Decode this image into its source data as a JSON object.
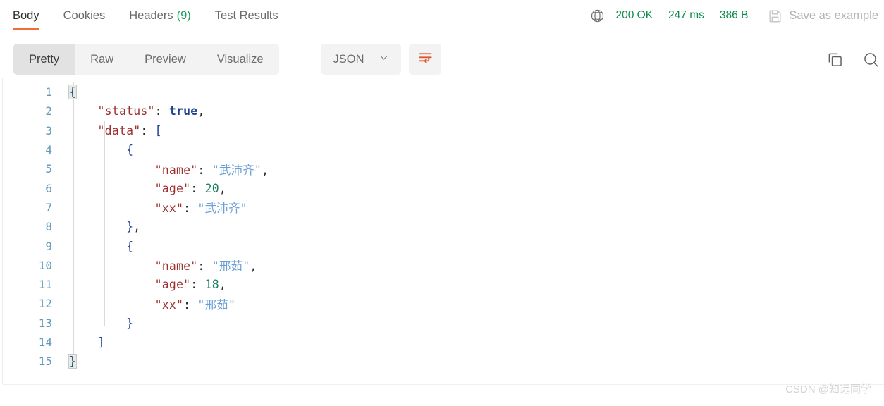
{
  "response_header": {
    "tabs": [
      {
        "label": "Body",
        "count": "",
        "active": true
      },
      {
        "label": "Cookies",
        "count": "",
        "active": false
      },
      {
        "label": "Headers",
        "count": "(9)",
        "active": false
      },
      {
        "label": "Test Results",
        "count": "",
        "active": false
      }
    ],
    "globe_icon": "globe-icon",
    "status_code": "200 OK",
    "response_time": "247 ms",
    "response_size": "386 B",
    "save_icon": "floppy-disk-icon",
    "save_as_example": "Save as example"
  },
  "toolbar": {
    "view_modes": [
      {
        "label": "Pretty",
        "active": true
      },
      {
        "label": "Raw",
        "active": false
      },
      {
        "label": "Preview",
        "active": false
      },
      {
        "label": "Visualize",
        "active": false
      }
    ],
    "format_selected": "JSON",
    "format_chevron_icon": "chevron-down-icon",
    "wrap_icon": "word-wrap-icon",
    "copy_icon": "copy-icon",
    "search_icon": "search-icon"
  },
  "code": {
    "language": "json",
    "lines": [
      {
        "no": "1",
        "html": "<span class=\"brk hl\">{</span>"
      },
      {
        "no": "2",
        "html": "    <span class=\"k\">\"status\"</span><span class=\"p\">:</span> <span class=\"b\">true</span><span class=\"p\">,</span>"
      },
      {
        "no": "3",
        "html": "    <span class=\"k\">\"data\"</span><span class=\"p\">:</span> <span class=\"brk\">[</span>"
      },
      {
        "no": "4",
        "html": "        <span class=\"brk\">{</span>"
      },
      {
        "no": "5",
        "html": "            <span class=\"k\">\"name\"</span><span class=\"p\">:</span> <span class=\"s\">\"武沛齐\"</span><span class=\"p\">,</span>"
      },
      {
        "no": "6",
        "html": "            <span class=\"k\">\"age\"</span><span class=\"p\">:</span> <span class=\"n\">20</span><span class=\"p\">,</span>"
      },
      {
        "no": "7",
        "html": "            <span class=\"k\">\"xx\"</span><span class=\"p\">:</span> <span class=\"s\">\"武沛齐\"</span>"
      },
      {
        "no": "8",
        "html": "        <span class=\"brk\">}</span><span class=\"p\">,</span>"
      },
      {
        "no": "9",
        "html": "        <span class=\"brk\">{</span>"
      },
      {
        "no": "10",
        "html": "            <span class=\"k\">\"name\"</span><span class=\"p\">:</span> <span class=\"s\">\"邢茹\"</span><span class=\"p\">,</span>"
      },
      {
        "no": "11",
        "html": "            <span class=\"k\">\"age\"</span><span class=\"p\">:</span> <span class=\"n\">18</span><span class=\"p\">,</span>"
      },
      {
        "no": "12",
        "html": "            <span class=\"k\">\"xx\"</span><span class=\"p\">:</span> <span class=\"s\">\"邢茹\"</span>"
      },
      {
        "no": "13",
        "html": "        <span class=\"brk\">}</span>"
      },
      {
        "no": "14",
        "html": "    <span class=\"brk\">]</span>"
      },
      {
        "no": "15",
        "html": "<span class=\"brk hl\">}</span>"
      }
    ],
    "raw_json": {
      "status": true,
      "data": [
        {
          "name": "武沛齐",
          "age": 20,
          "xx": "武沛齐"
        },
        {
          "name": "邢茹",
          "age": 18,
          "xx": "邢茹"
        }
      ]
    }
  },
  "watermark": "CSDN @知远同学",
  "colors": {
    "accent_orange": "#f26b3a",
    "status_green": "#0e8c4e",
    "json_key": "#a03030",
    "json_string": "#6b9ed4",
    "json_number": "#1a7f5a",
    "json_boolean": "#1d3f8f",
    "line_number": "#5f9ab8",
    "pill_bg": "#f3f3f3",
    "pill_active_bg": "#e2e2e2"
  }
}
